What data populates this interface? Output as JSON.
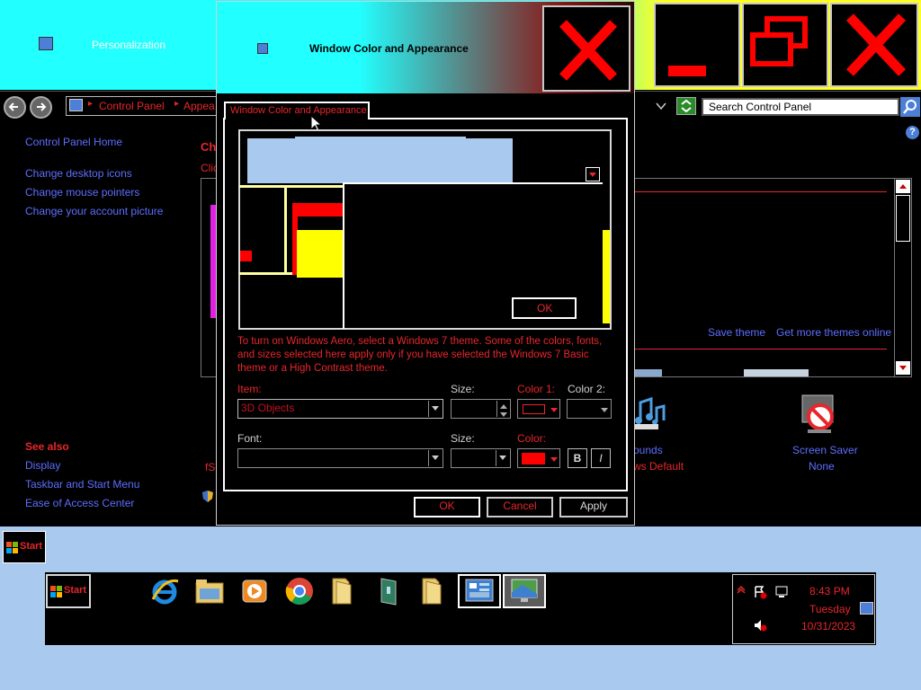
{
  "personalization": {
    "title": "Personalization"
  },
  "addressbar": {
    "crumb1": "Control Panel",
    "crumb2": "Appea",
    "search_placeholder": "Search Control Panel"
  },
  "sidebar": {
    "home": "Control Panel Home",
    "links": [
      "Change desktop icons",
      "Change mouse pointers",
      "Change your account picture"
    ],
    "see_also_title": "See also",
    "see_also": [
      "Display",
      "Taskbar and Start Menu",
      "Ease of Access Center"
    ]
  },
  "main": {
    "heading_partial": "Ch",
    "sub_partial": "Clic",
    "save_theme": "Save theme",
    "more_themes": "Get more themes online",
    "sounds_label": "ounds",
    "sounds_value": "ws Default",
    "screensaver_label": "Screen Saver",
    "screensaver_value": "None",
    "left_partial": "fSe"
  },
  "dialog": {
    "title": "Window Color and Appearance",
    "tab": "Window Color and Appearance",
    "preview_ok": "OK",
    "info": "To turn on Windows Aero, select a Windows 7 theme.  Some of the colors, fonts, and sizes selected here apply only if you have selected the Windows 7 Basic theme or a High Contrast theme.",
    "item_label": "Item:",
    "item_value": "3D Objects",
    "size_label": "Size:",
    "color1_label": "Color 1:",
    "color2_label": "Color 2:",
    "font_label": "Font:",
    "font_size_label": "Size:",
    "color_label": "Color:",
    "bold": "B",
    "italic": "I",
    "ok": "OK",
    "cancel": "Cancel",
    "apply": "Apply"
  },
  "taskbar": {
    "start": "Start",
    "time": "8:43 PM",
    "day": "Tuesday",
    "date": "10/31/2023"
  },
  "colors": {
    "accent_red": "#e8262b",
    "link_blue": "#5d6eff",
    "preview_blue": "#a9c9ee",
    "desktop": "#a9c9ee"
  }
}
